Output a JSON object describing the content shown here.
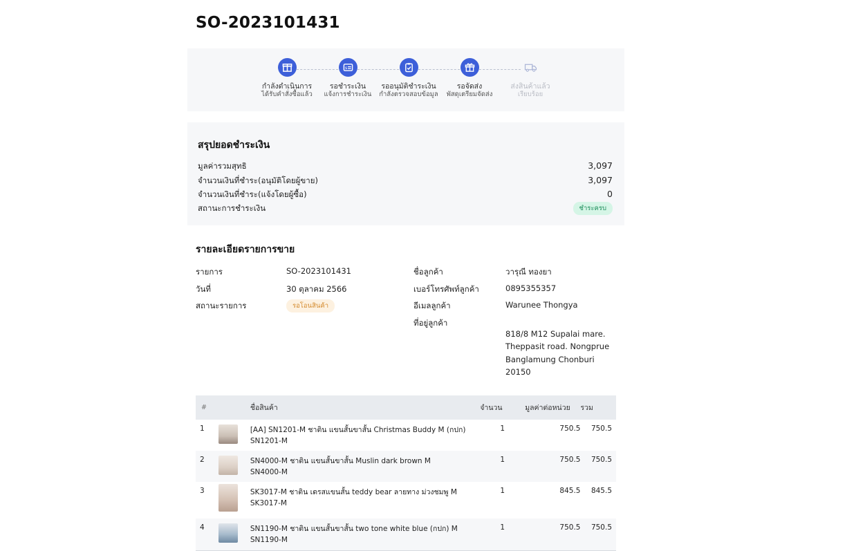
{
  "order": {
    "title": "SO-2023101431"
  },
  "steps": [
    {
      "label": "กำลังดำเนินการ",
      "sub": "ได้รับคำสั่งซื้อแล้ว",
      "icon": "box-icon",
      "state": "done"
    },
    {
      "label": "รอชำระเงิน",
      "sub": "แจ้งการชำระเงิน",
      "icon": "payment-card-icon",
      "state": "done"
    },
    {
      "label": "รออนุมัติชำระเงิน",
      "sub": "กำลังตรวจสอบข้อมูล",
      "icon": "clipboard-check-icon",
      "state": "done"
    },
    {
      "label": "รอจัดส่ง",
      "sub": "พัสดุเตรียมจัดส่ง",
      "icon": "gift-box-icon",
      "state": "done"
    },
    {
      "label": "ส่งสินค้าแล้ว",
      "sub": "เรียบร้อย",
      "icon": "truck-icon",
      "state": "pending"
    }
  ],
  "summary": {
    "title": "สรุปยอดชำระเงิน",
    "rows": [
      {
        "label": "มูลค่ารวมสุทธิ",
        "value": "3,097"
      },
      {
        "label": "จำนวนเงินที่ชำระ(อนุมัติโดยผู้ขาย)",
        "value": "3,097"
      },
      {
        "label": "จำนวนเงินที่ชำระ(แจ้งโดยผู้ซื้อ)",
        "value": "0"
      }
    ],
    "status_label": "สถานะการชำระเงิน",
    "status_badge": "ชำระครบ"
  },
  "details": {
    "title": "รายละเอียดรายการขาย",
    "item_label": "รายการ",
    "item_value": "SO-2023101431",
    "date_label": "วันที่",
    "date_value": "30 ตุลาคม 2566",
    "status_label": "สถานะรายการ",
    "status_badge": "รอโอนสินค้า",
    "customer_name_label": "ชื่อลูกค้า",
    "customer_name_value": "วารุณี ทองยา",
    "phone_label": "เบอร์โทรศัพท์ลูกค้า",
    "phone_value": "0895355357",
    "email_label": "อีเมลลูกค้า",
    "email_value": "Warunee Thongya",
    "address_label": "ที่อยู่ลูกค้า",
    "address_value": "818/8 M12 Supalai mare. Theppasit road. Nongprue Banglamung Chonburi 20150"
  },
  "table": {
    "headers": {
      "index": "#",
      "name": "ชื่อสินค้า",
      "qty": "จำนวน",
      "unit_price": "มูลค่าต่อหน่วย",
      "total": "รวม"
    },
    "rows": [
      {
        "index": "1",
        "name": "[AA] SN1201-M ชาติน แขนสั้นขาสั้น Christmas Buddy M (กปก)",
        "sku": "SN1201-M",
        "qty": "1",
        "unit_price": "750.5",
        "total": "750.5",
        "thumb_color": "#d9cfc6"
      },
      {
        "index": "2",
        "name": "SN4000-M ชาติน แขนสั้นขาสั้น Muslin dark brown M",
        "sku": "SN4000-M",
        "qty": "1",
        "unit_price": "750.5",
        "total": "750.5",
        "thumb_color": "#e6dcd3"
      },
      {
        "index": "3",
        "name": "SK3017-M ชาติน เดรสแขนสั้น teddy bear ลายทาง ม่วงชมพู M",
        "sku": "SK3017-M",
        "qty": "1",
        "unit_price": "845.5",
        "total": "845.5",
        "thumb_color": "#dccabb"
      },
      {
        "index": "4",
        "name": "SN1190-M ชาติน แขนสั้นขาสั้น two tone white blue (กปก) M",
        "sku": "SN1190-M",
        "qty": "1",
        "unit_price": "750.5",
        "total": "750.5",
        "thumb_color": "#b9c6d2"
      }
    ]
  },
  "colors": {
    "accent": "#3d5fd9",
    "paid_badge_bg": "#d5f5e6",
    "paid_badge_text": "#1d8d5a",
    "wait_badge_bg": "#fdf1e0",
    "wait_badge_text": "#d48a2d"
  }
}
